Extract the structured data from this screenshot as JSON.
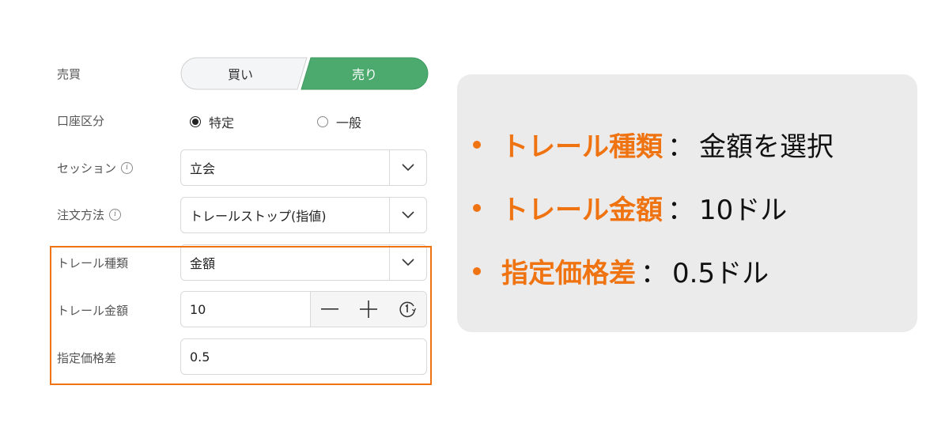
{
  "form": {
    "side": {
      "label": "売買",
      "buy_label": "買い",
      "sell_label": "売り",
      "selected": "売り"
    },
    "account": {
      "label": "口座区分",
      "options": [
        "特定",
        "一般"
      ],
      "selected": "特定"
    },
    "session": {
      "label": "セッション",
      "value": "立会"
    },
    "order_method": {
      "label": "注文方法",
      "value": "トレールストップ(指値)"
    },
    "trail_type": {
      "label": "トレール種類",
      "value": "金額"
    },
    "trail_amount": {
      "label": "トレール金額",
      "value": "10"
    },
    "limit_diff": {
      "label": "指定価格差",
      "value": "0.5"
    }
  },
  "panel": {
    "items": [
      {
        "key": "トレール種類",
        "sep": "：",
        "value": "金額を選択"
      },
      {
        "key": "トレール金額",
        "sep": "：",
        "value": "10ドル"
      },
      {
        "key": "指定価格差",
        "sep": "：",
        "value": "0.5ドル"
      }
    ]
  },
  "colors": {
    "sell_active": "#4caa6e",
    "highlight": "#f07312",
    "panel_bg": "#ebebeb"
  },
  "icons": {
    "info": "info-icon",
    "dropdown": "chevron-down-icon",
    "minus": "minus-icon",
    "plus": "plus-icon",
    "step": "step-size-icon"
  }
}
